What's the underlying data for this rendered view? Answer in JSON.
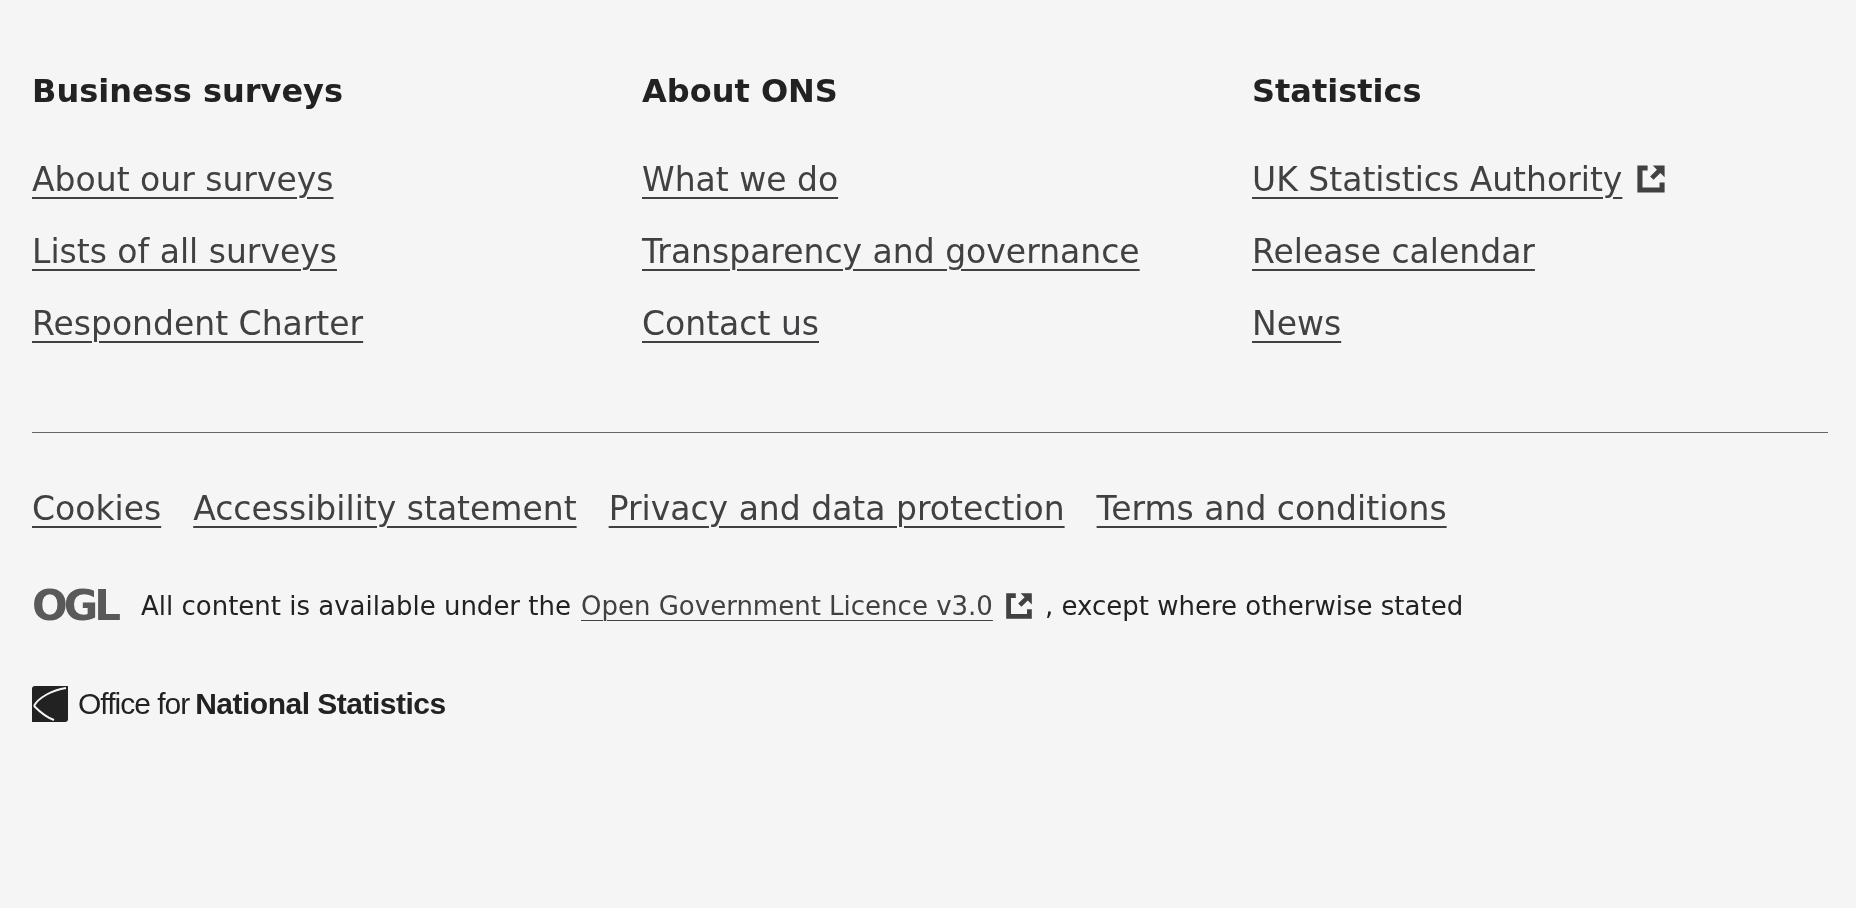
{
  "columns": [
    {
      "heading": "Business surveys",
      "links": [
        {
          "label": "About our surveys",
          "external": false
        },
        {
          "label": "Lists of all surveys",
          "external": false
        },
        {
          "label": "Respondent Charter",
          "external": false
        }
      ]
    },
    {
      "heading": "About ONS",
      "links": [
        {
          "label": "What we do",
          "external": false
        },
        {
          "label": "Transparency and governance",
          "external": false
        },
        {
          "label": "Contact us",
          "external": false
        }
      ]
    },
    {
      "heading": "Statistics",
      "links": [
        {
          "label": "UK Statistics Authority",
          "external": true
        },
        {
          "label": "Release calendar",
          "external": false
        },
        {
          "label": "News",
          "external": false
        }
      ]
    }
  ],
  "legal_links": [
    "Cookies",
    "Accessibility statement",
    "Privacy and data protection",
    "Terms and conditions"
  ],
  "licence": {
    "logo": "OGL",
    "before": "All content is available under the",
    "link": "Open Government Licence v3.0",
    "external": true,
    "after": ", except where otherwise stated"
  },
  "brand": {
    "light": "Office for",
    "bold": "National Statistics"
  }
}
